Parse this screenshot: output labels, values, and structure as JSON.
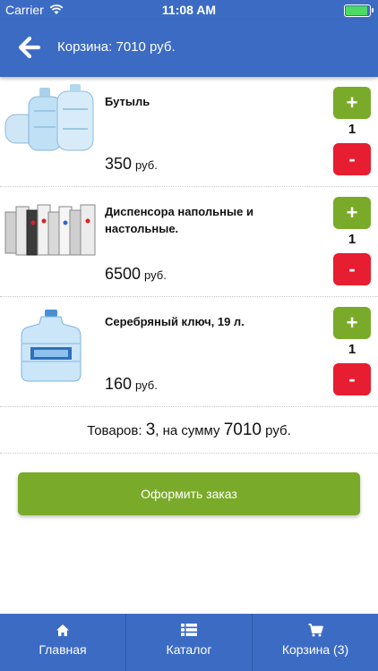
{
  "status_bar": {
    "carrier": "Carrier",
    "time": "11:08 AM"
  },
  "header": {
    "title": "Корзина: 7010 руб."
  },
  "cart_items": [
    {
      "name": "Бутыль",
      "price": "350",
      "currency": "руб.",
      "quantity": "1",
      "plus": "+",
      "minus": "-"
    },
    {
      "name": "Диспенсора напольные и настольные.",
      "price": "6500",
      "currency": "руб.",
      "quantity": "1",
      "plus": "+",
      "minus": "-"
    },
    {
      "name": "Серебряный ключ, 19 л.",
      "price": "160",
      "currency": "руб.",
      "quantity": "1",
      "plus": "+",
      "minus": "-"
    }
  ],
  "summary": {
    "label": "Товаров:",
    "count": "3",
    "middle": ", на сумму",
    "total": "7010",
    "currency": "руб."
  },
  "order_button": {
    "label": "Оформить заказ"
  },
  "tabbar": [
    {
      "icon": "home-icon",
      "label": "Главная"
    },
    {
      "icon": "catalog-list-icon",
      "label": "Каталог"
    },
    {
      "icon": "cart-icon",
      "label": "Корзина (3)"
    }
  ],
  "colors": {
    "primary": "#3c6bc4",
    "green": "#7aaa2a",
    "red": "#e71d31"
  }
}
